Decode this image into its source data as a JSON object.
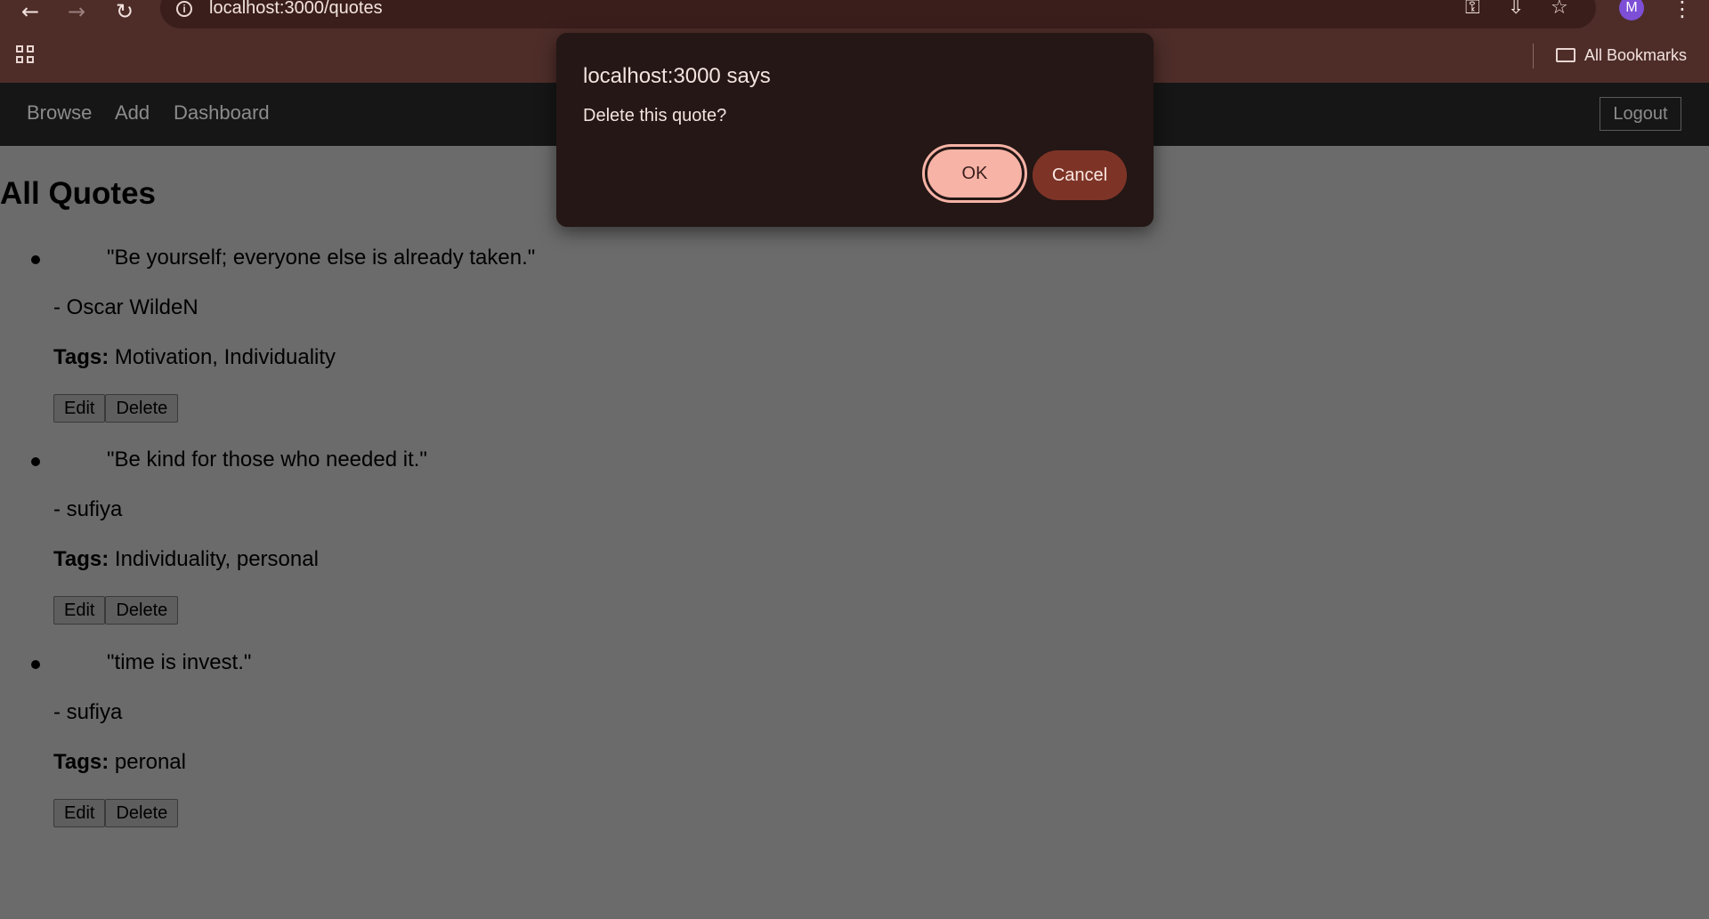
{
  "browser": {
    "url": "localhost:3000/quotes",
    "avatar_letter": "M",
    "bookmarks_label": "All Bookmarks"
  },
  "nav": {
    "links": [
      "Browse",
      "Add",
      "Dashboard"
    ],
    "logout_label": "Logout"
  },
  "page": {
    "title": "All Quotes",
    "tags_label": "Tags:",
    "edit_label": "Edit",
    "delete_label": "Delete",
    "quotes": [
      {
        "text": "\"Be yourself; everyone else is already taken.\"",
        "author": "- Oscar WildeN",
        "tags": "Motivation, Individuality"
      },
      {
        "text": "\"Be kind for those who needed it.\"",
        "author": "- sufiya",
        "tags": "Individuality, personal"
      },
      {
        "text": "\"time is invest.\"",
        "author": "- sufiya",
        "tags": "peronal"
      }
    ]
  },
  "dialog": {
    "title": "localhost:3000 says",
    "message": "Delete this quote?",
    "ok_label": "OK",
    "cancel_label": "Cancel"
  }
}
